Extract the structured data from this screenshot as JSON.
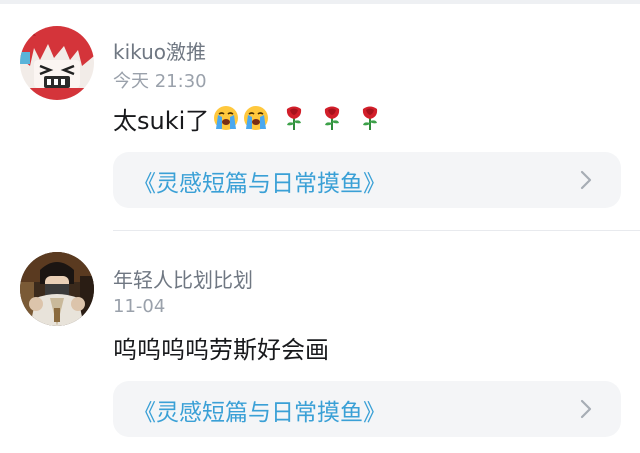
{
  "comments": [
    {
      "username": "kikuo激推",
      "time": "今天 21:30",
      "text": "太suki了",
      "emojis": [
        "loudly-crying-face-icon",
        "loudly-crying-face-icon",
        "rose-icon",
        "rose-icon",
        "rose-icon"
      ],
      "link": "《灵感短篇与日常摸鱼》"
    },
    {
      "username": "年轻人比划比划",
      "time": "11-04",
      "text": "呜呜呜呜劳斯好会画",
      "emojis": [],
      "link": "《灵感短篇与日常摸鱼》"
    }
  ],
  "colors": {
    "link": "#3aa0d6",
    "username": "#6f7782",
    "timestamp": "#9aa1ab",
    "card_bg": "#f4f5f7"
  }
}
